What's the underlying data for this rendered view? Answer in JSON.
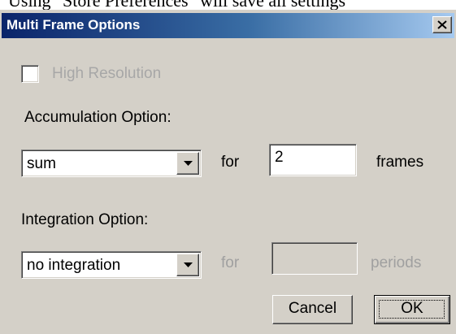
{
  "background_text": "Using \"Store Preferences\" will save all settings",
  "window": {
    "title": "Multi Frame Options",
    "close_glyph": "close-icon"
  },
  "high_resolution": {
    "label": "High Resolution",
    "checked": false,
    "enabled": false
  },
  "accumulation": {
    "heading": "Accumulation Option:",
    "selected": "sum",
    "for_label": "for",
    "count_value": "2",
    "unit_label": "frames"
  },
  "integration": {
    "heading": "Integration Option:",
    "selected": "no integration",
    "for_label": "for",
    "count_value": "",
    "unit_label": "periods",
    "enabled": false
  },
  "buttons": {
    "cancel_label": "Cancel",
    "ok_label": "OK"
  },
  "colors": {
    "dialog_face": "#d4d0c8",
    "title_start": "#0a246a",
    "title_end": "#a6caf0",
    "disabled_text": "#a0a0a0"
  }
}
